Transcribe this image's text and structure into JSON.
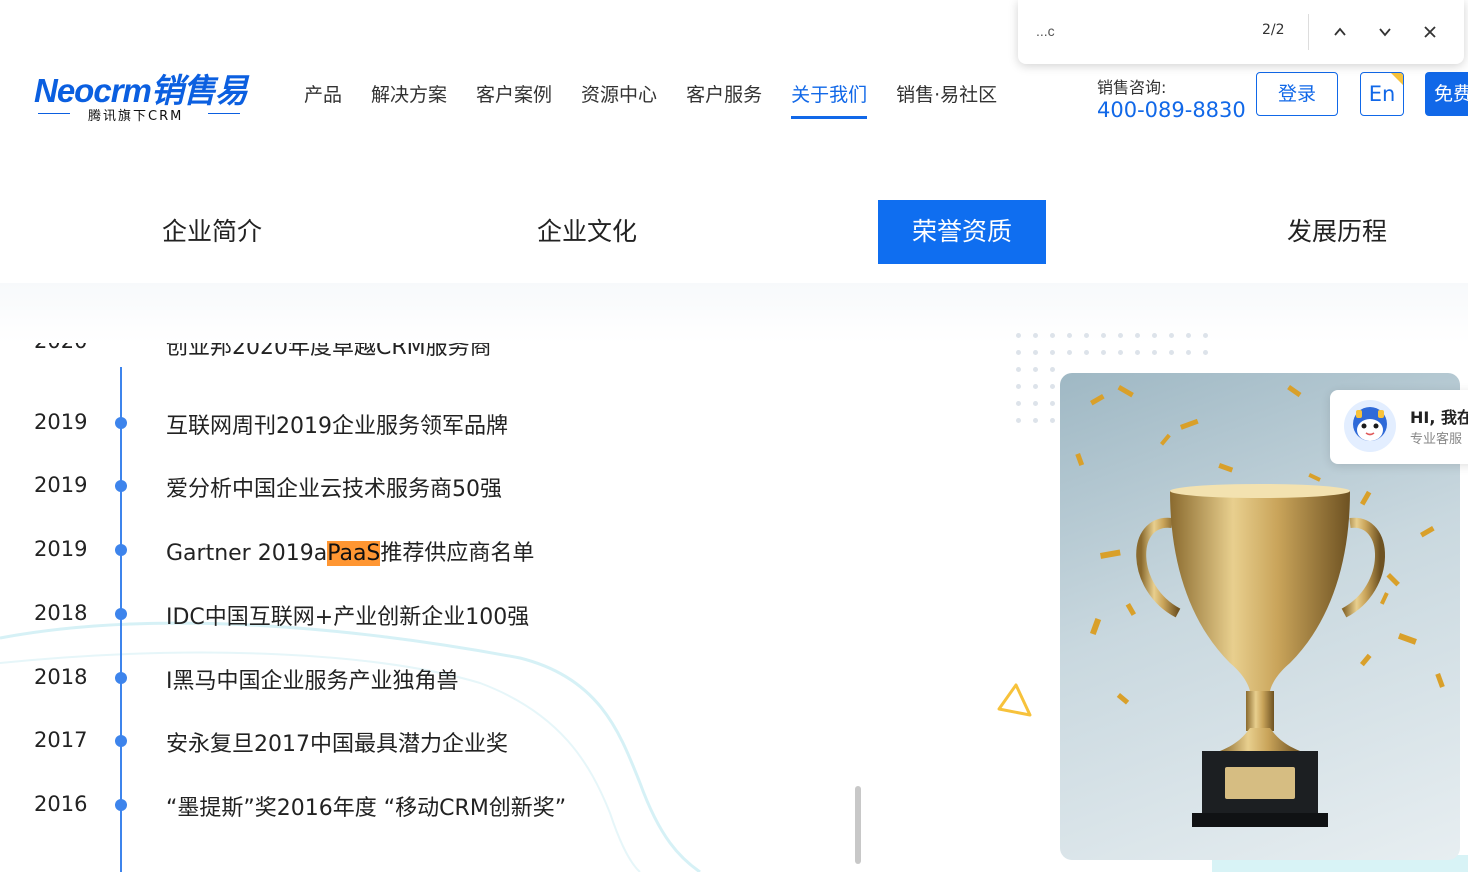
{
  "header": {
    "logo_text": "Neocrm销售易",
    "logo_sub": "腾讯旗下CRM",
    "nav": [
      {
        "label": "产品",
        "active": false
      },
      {
        "label": "解决方案",
        "active": false
      },
      {
        "label": "客户案例",
        "active": false
      },
      {
        "label": "资源中心",
        "active": false
      },
      {
        "label": "客户服务",
        "active": false
      },
      {
        "label": "关于我们",
        "active": true
      },
      {
        "label": "销售·易社区",
        "active": false
      }
    ],
    "contact_label": "销售咨询:",
    "contact_phone": "400-089-8830",
    "login_label": "登录",
    "lang_label": "En",
    "free_label": "免费"
  },
  "find_bar": {
    "query": "...c",
    "count": "2/2",
    "prev_icon": "chevron-up-icon",
    "next_icon": "chevron-down-icon",
    "close_icon": "close-icon"
  },
  "subtabs": [
    {
      "label": "企业简介",
      "active": false
    },
    {
      "label": "企业文化",
      "active": false
    },
    {
      "label": "荣誉资质",
      "active": true
    },
    {
      "label": "发展历程",
      "active": false
    }
  ],
  "honors": [
    {
      "year": "2019",
      "title": "互联网周刊2019企业服务领军品牌"
    },
    {
      "year": "2019",
      "title": "爱分析中国企业云技术服务商50强"
    },
    {
      "year": "2019",
      "title_before": "Gartner 2019a",
      "title_highlight": "PaaS",
      "title_after": "推荐供应商名单"
    },
    {
      "year": "2018",
      "title": "IDC中国互联网+产业创新企业100强"
    },
    {
      "year": "2018",
      "title": "I黑马中国企业服务产业独角兽"
    },
    {
      "year": "2017",
      "title": "安永复旦2017中国最具潜力企业奖"
    },
    {
      "year": "2016",
      "title": "“墨提斯”奖2016年度 “移动CRM创新奖”"
    }
  ],
  "chat": {
    "greeting": "HI, 我在",
    "subtitle": "专业客服"
  },
  "colors": {
    "brand_blue": "#1168e8",
    "tab_active": "#0f6ef0",
    "timeline_blue": "#3d84ec",
    "highlight": "#ff9632"
  }
}
